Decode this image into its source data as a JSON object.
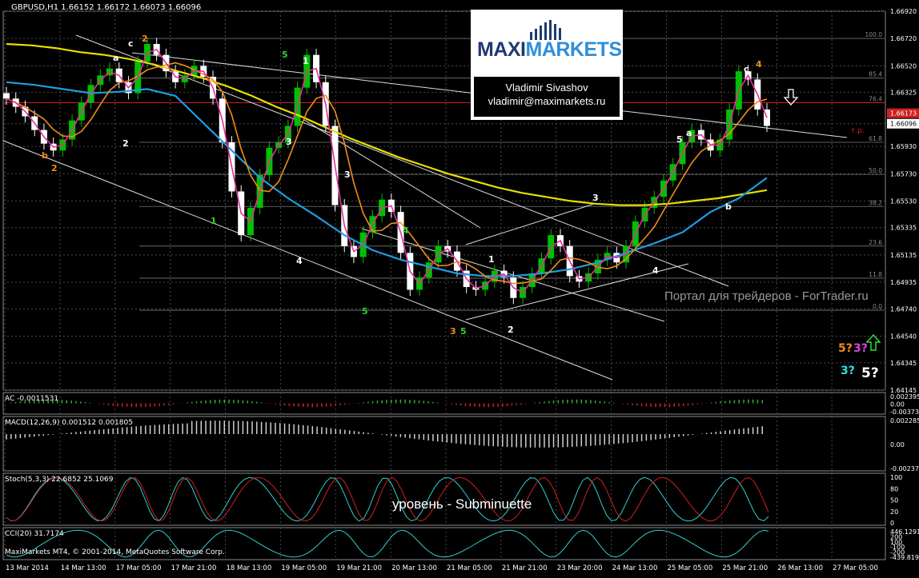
{
  "window": {
    "header": "GBPUSD,H1  1.66152 1.66172 1.66073 1.66096",
    "footer": "MaxiMarkets MT4, © 2001-2014, MetaQuotes Software Corp."
  },
  "logo": {
    "brand_left": "MAXI",
    "brand_right": "MARKETS",
    "name": "Vladimir Sivashov",
    "email": "vladimir@maximarkets.ru"
  },
  "watermark": "Портал для трейдеров - ForTrader.ru",
  "level_caption": "уровень - Subminuette",
  "colors": {
    "background": "#000000",
    "grid": "#4a4a4a",
    "bull": "#00c000",
    "bear": "#ffffff",
    "ma_yellow": "#e8e000",
    "ma_blue": "#1e9ce0",
    "ma_orange": "#f08c1c",
    "ma_magenta": "#e0309a",
    "price_line": "#d02020"
  },
  "chart_data": [
    {
      "type": "line",
      "panel": "price",
      "symbol": "GBPUSD",
      "timeframe": "H1",
      "ohlc_header": {
        "open": 1.66152,
        "high": 1.66172,
        "low": 1.66073,
        "close": 1.66096
      },
      "ylim": [
        1.64145,
        1.6692
      ],
      "y_ticks": [
        "1.66920",
        "1.66720",
        "1.66520",
        "1.66325",
        "1.66096",
        "1.65930",
        "1.65730",
        "1.65530",
        "1.65335",
        "1.65135",
        "1.64935",
        "1.64740",
        "1.64540",
        "1.64345",
        "1.64145"
      ],
      "current_price_label": "1.66096",
      "pending_label": "1.66173",
      "x_ticks": [
        "13 Mar 2014",
        "14 Mar 13:00",
        "17 Mar 05:00",
        "17 Mar 21:00",
        "18 Mar 13:00",
        "19 Mar 05:00",
        "19 Mar 21:00",
        "20 Mar 13:00",
        "21 Mar 05:00",
        "21 Mar 21:00",
        "23 Mar 20:00",
        "24 Mar 13:00",
        "25 Mar 05:00",
        "25 Mar 21:00",
        "26 Mar 13:00",
        "27 Mar 05:00"
      ],
      "fib_levels": [
        {
          "label": "100.0",
          "price": 1.6672
        },
        {
          "label": "85.4",
          "price": 1.6643
        },
        {
          "label": "76.4",
          "price": 1.6625
        },
        {
          "label": "61.8",
          "price": 1.6596
        },
        {
          "label": "50.0",
          "price": 1.65725
        },
        {
          "label": "38.2",
          "price": 1.6549
        },
        {
          "label": "23.6",
          "price": 1.652
        },
        {
          "label": "11.8",
          "price": 1.64965
        },
        {
          "label": "0.0",
          "price": 1.6473
        }
      ],
      "tp_label": "т.р.",
      "close": [
        1.6628,
        1.6622,
        1.6615,
        1.6605,
        1.6595,
        1.659,
        1.6598,
        1.6612,
        1.6625,
        1.6638,
        1.6645,
        1.665,
        1.664,
        1.6632,
        1.6655,
        1.6668,
        1.666,
        1.6648,
        1.664,
        1.6645,
        1.6652,
        1.6644,
        1.6628,
        1.6596,
        1.656,
        1.6528,
        1.6548,
        1.6572,
        1.6592,
        1.6596,
        1.6608,
        1.6636,
        1.666,
        1.664,
        1.6608,
        1.655,
        1.652,
        1.6512,
        1.653,
        1.6542,
        1.6554,
        1.6545,
        1.6515,
        1.6488,
        1.6497,
        1.6508,
        1.652,
        1.6516,
        1.6502,
        1.649,
        1.6488,
        1.6494,
        1.6502,
        1.6497,
        1.6482,
        1.649,
        1.65,
        1.6511,
        1.6528,
        1.652,
        1.6498,
        1.6494,
        1.65,
        1.651,
        1.6515,
        1.6508,
        1.652,
        1.6538,
        1.6548,
        1.6556,
        1.6568,
        1.658,
        1.6596,
        1.6605,
        1.6598,
        1.659,
        1.6598,
        1.662,
        1.6648,
        1.6642,
        1.662,
        1.6608
      ],
      "ohlc_comment": "close series above drives candlesticks; opens are previous closes",
      "series": [
        {
          "name": "",
          "color": "#e8e000",
          "values": [
            1.6668,
            1.6667,
            1.6665,
            1.6662,
            1.666,
            1.6657,
            1.6653,
            1.6648,
            1.6643,
            1.6637,
            1.663,
            1.6622,
            1.6615,
            1.6607,
            1.6599,
            1.6592,
            1.6585,
            1.6579,
            1.6573,
            1.6568,
            1.6563,
            1.6559,
            1.6556,
            1.6553,
            1.6551,
            1.655,
            1.655,
            1.6551,
            1.6553,
            1.6555,
            1.6558,
            1.6561
          ]
        },
        {
          "name": "",
          "color": "#1e9ce0",
          "values": [
            1.664,
            1.6638,
            1.6635,
            1.6632,
            1.6633,
            1.6635,
            1.663,
            1.661,
            1.659,
            1.657,
            1.6555,
            1.6542,
            1.6528,
            1.6517,
            1.651,
            1.6505,
            1.65,
            1.6498,
            1.6498,
            1.65,
            1.6503,
            1.6508,
            1.6515,
            1.6522,
            1.653,
            1.6545,
            1.6555,
            1.657
          ]
        }
      ],
      "wave_labels": [
        "a",
        "c",
        "2",
        "5",
        "1",
        "b",
        "2",
        "2",
        "1",
        "3",
        "4",
        "3",
        "5",
        "4",
        "3",
        "5",
        "1",
        "2",
        "3",
        "5",
        "4",
        "a",
        "b",
        "c",
        "4",
        "5?",
        "3?",
        "3?",
        "5?"
      ]
    },
    {
      "type": "bar",
      "panel": "AC",
      "label": "AC -0.0011531",
      "y_ticks": [
        "0.002395",
        "0.00",
        "-0.003737"
      ]
    },
    {
      "type": "bar",
      "panel": "MACD",
      "label": "MACD(12,26,9) 0.001512 0.001805",
      "y_ticks": [
        "0.002285",
        "0.00",
        "-0.002379"
      ]
    },
    {
      "type": "line",
      "panel": "Stoch",
      "label": "Stoch(5,3,3) 22.6852 25.1069",
      "y_ticks": [
        "100",
        "80",
        "50",
        "20",
        "0"
      ]
    },
    {
      "type": "line",
      "panel": "CCI",
      "label": "CCI(20) 31.7174",
      "y_ticks": [
        "446.1291",
        "200",
        "100",
        "-100",
        "-200",
        "-439.8190"
      ]
    }
  ]
}
